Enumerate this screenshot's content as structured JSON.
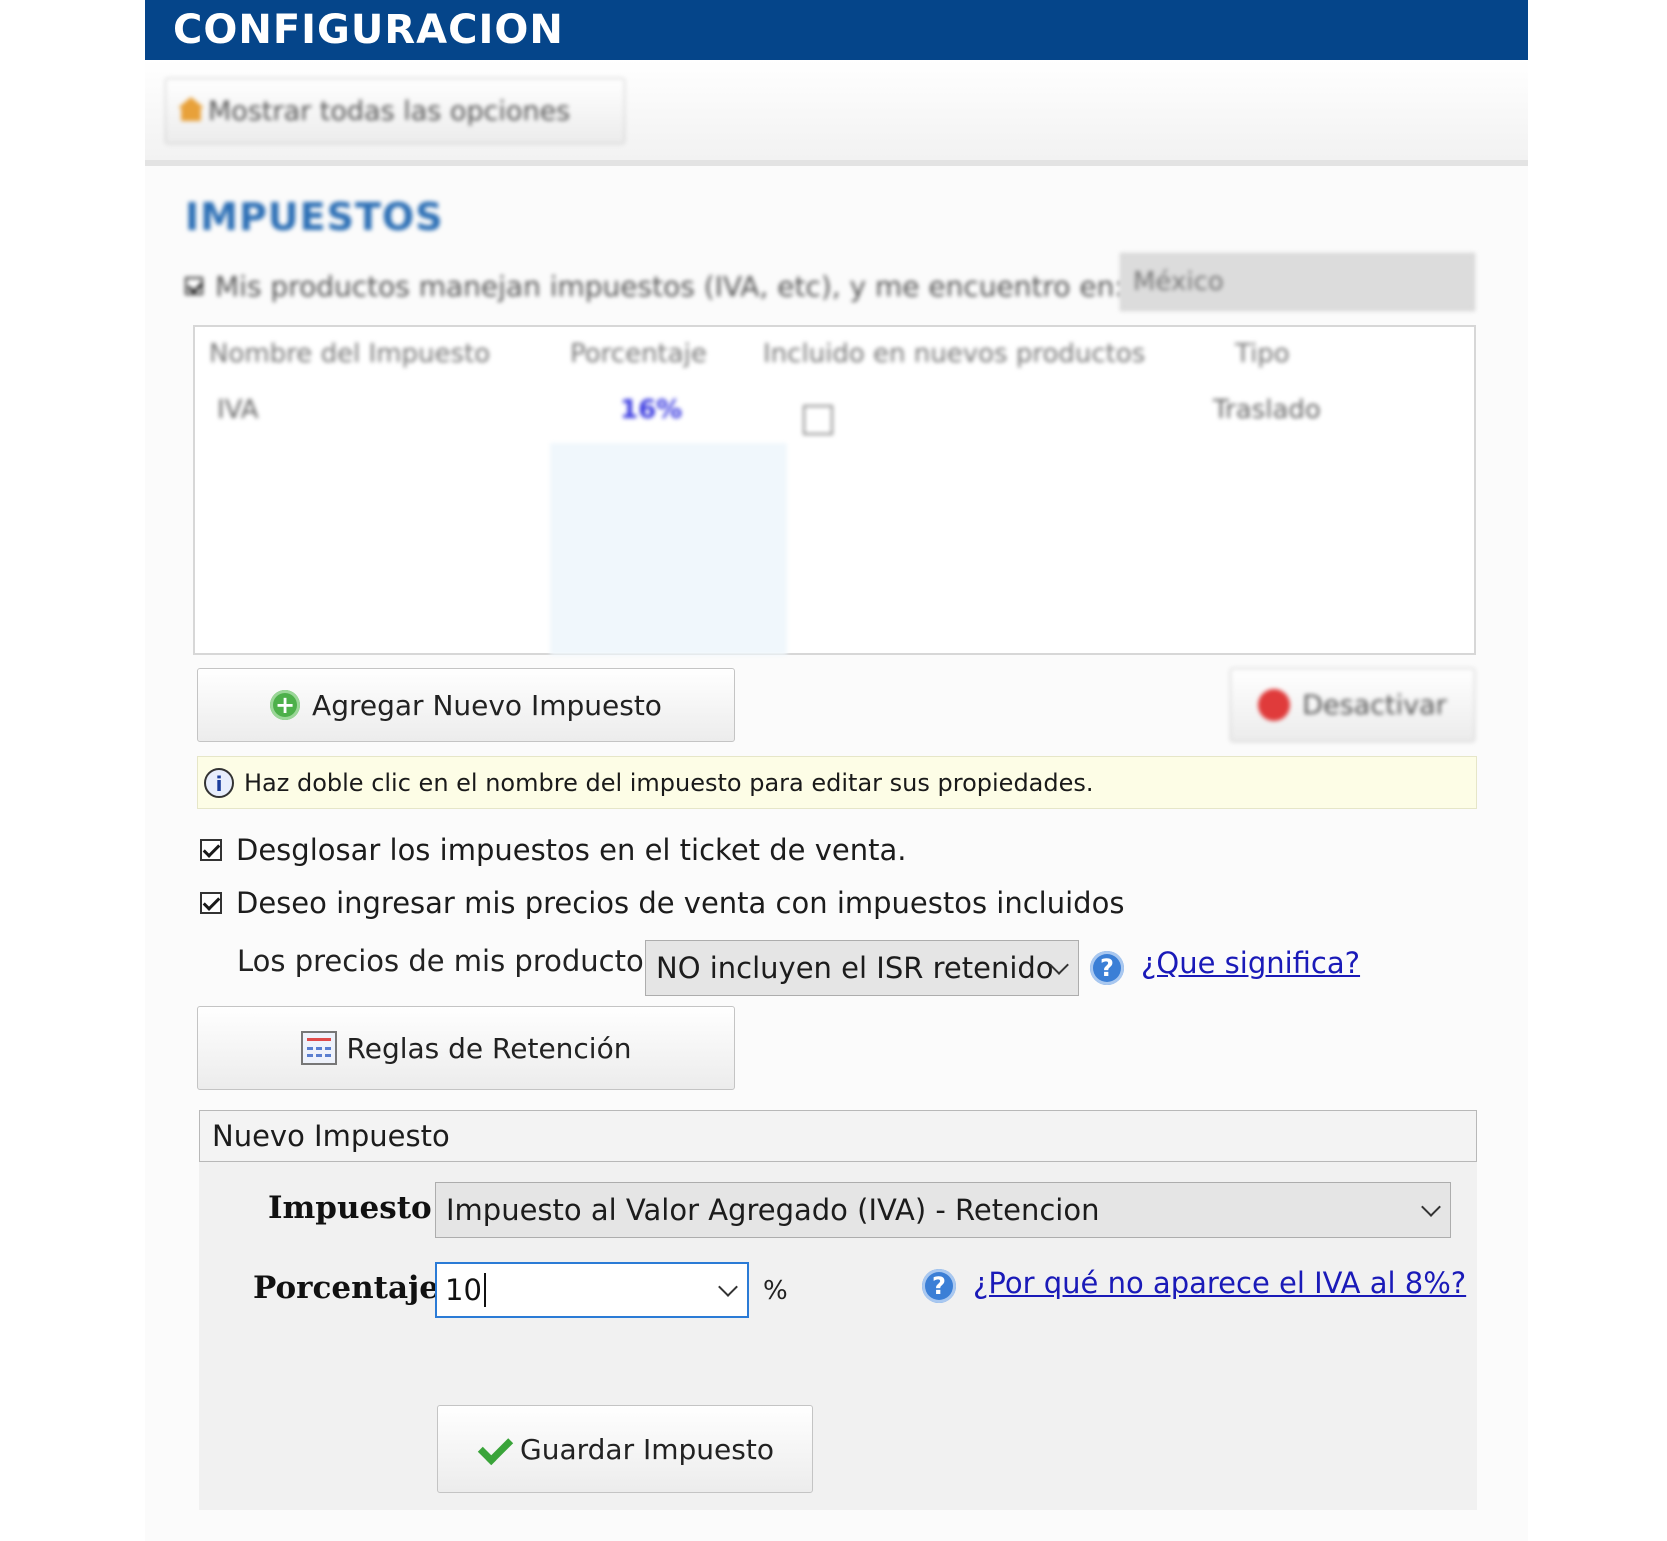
{
  "window": {
    "title": "CONFIGURACION"
  },
  "toolbar": {
    "show_all_label": "Mostrar todas las opciones"
  },
  "section": {
    "title": "IMPUESTOS"
  },
  "tax_handling": {
    "checkbox_label": "Mis productos manejan impuestos (IVA, etc), y me encuentro en:",
    "checked": true,
    "country": "México"
  },
  "tax_table": {
    "columns": [
      "Nombre del Impuesto",
      "Porcentaje",
      "Incluido en nuevos productos",
      "Tipo"
    ],
    "rows": [
      {
        "name": "IVA",
        "percentage": "16%",
        "included": false,
        "type": "Traslado"
      }
    ]
  },
  "buttons": {
    "add_tax": "Agregar Nuevo Impuesto",
    "deactivate": "Desactivar",
    "retention_rules": "Reglas de Retención",
    "save_tax": "Guardar Impuesto"
  },
  "info_bar": {
    "text": "Haz doble clic en el nombre del impuesto para editar sus propiedades."
  },
  "options": {
    "breakdown_label": "Desglosar los impuestos en el ticket de venta.",
    "breakdown_checked": true,
    "include_taxes_label": "Deseo ingresar mis precios de venta con impuestos incluidos",
    "include_taxes_checked": true
  },
  "isr": {
    "label": "Los precios de mis productos",
    "selected": "NO incluyen el ISR retenido",
    "help_link": "¿Que significa?"
  },
  "new_tax": {
    "header": "Nuevo Impuesto",
    "tax_label": "Impuesto",
    "tax_selected": "Impuesto al Valor Agregado (IVA) - Retencion",
    "percent_label": "Porcentaje",
    "percent_value": "10",
    "percent_sign": "%",
    "help_link": "¿Por qué no aparece el IVA al 8%?"
  },
  "icons": {
    "home": "home-icon",
    "add": "plus-circle-icon",
    "deactivate": "red-circle-icon",
    "info": "info-icon",
    "help": "question-icon",
    "rules": "rules-icon",
    "save": "checkmark-icon"
  },
  "colors": {
    "title_bar": "#05458a",
    "section_title": "#2c6fb5",
    "link": "#1a1ab8",
    "info_bar_bg": "#fdfde6",
    "input_focus": "#2b7bd6"
  }
}
